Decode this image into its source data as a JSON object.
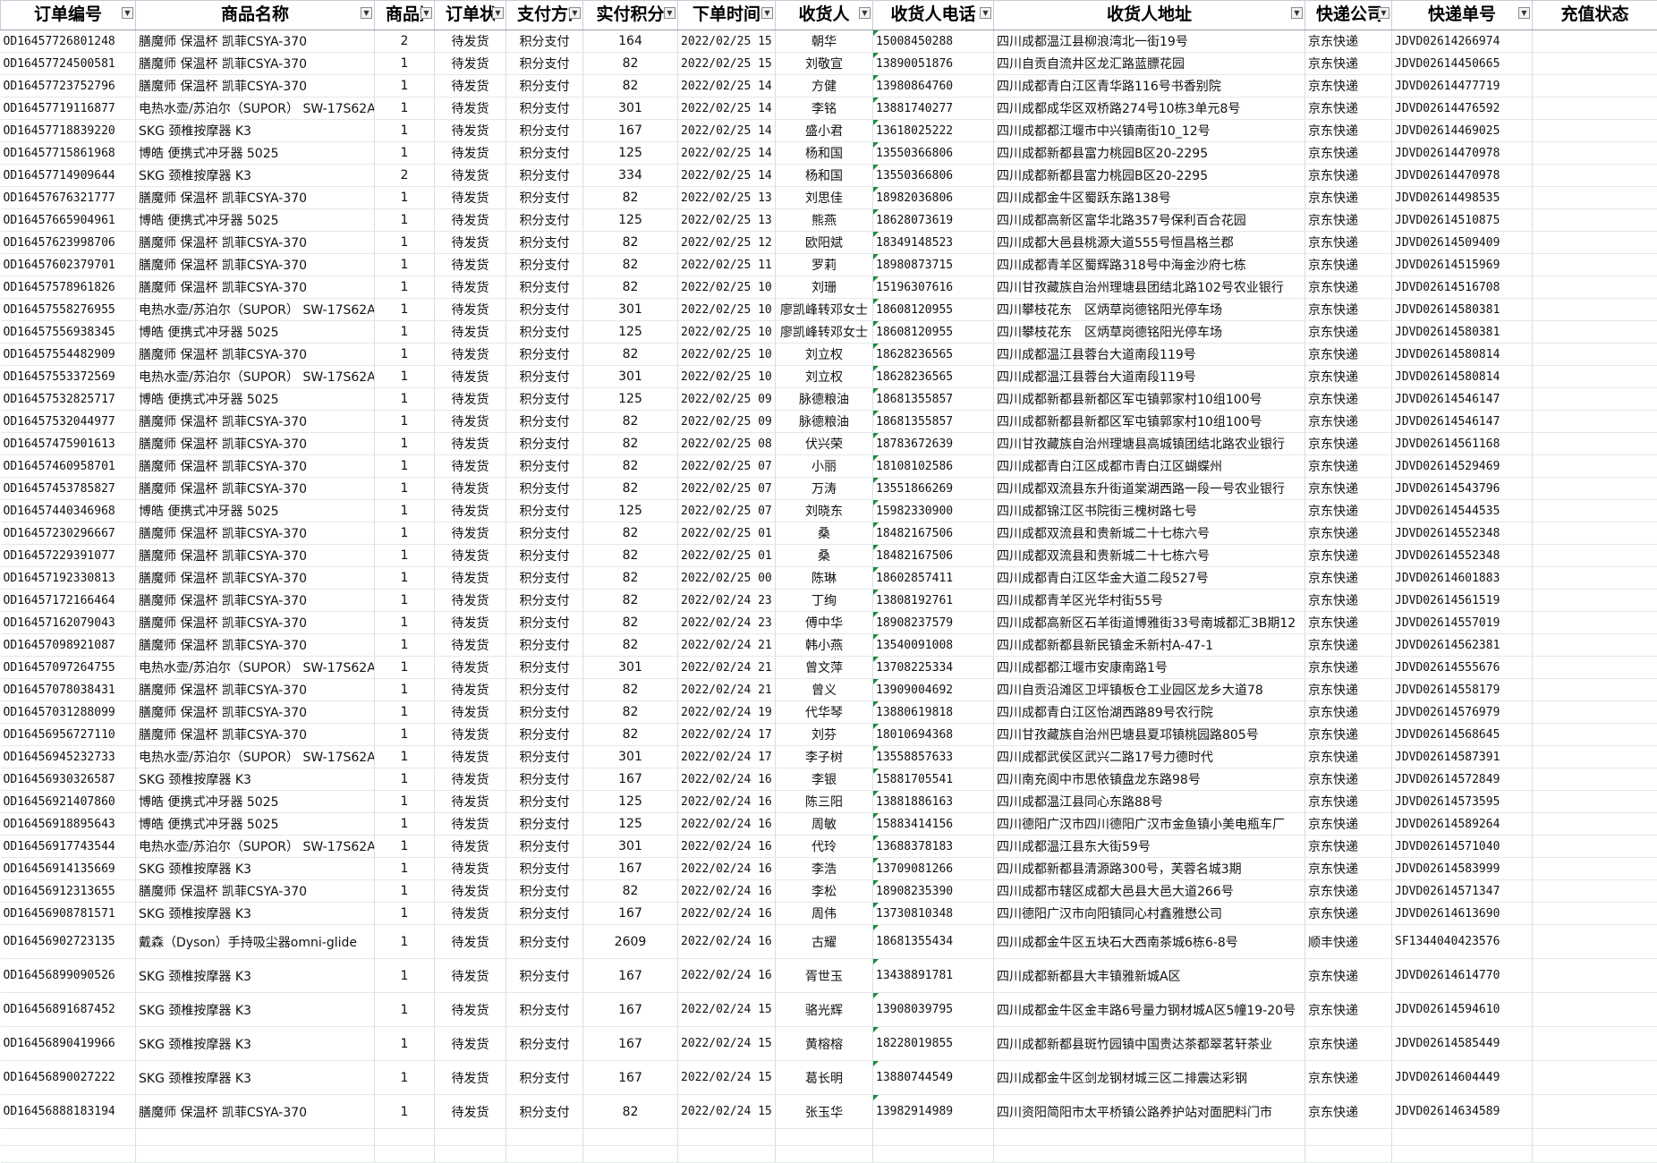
{
  "headers": [
    "订单编号",
    "商品名称",
    "商品数",
    "订单状",
    "支付方式",
    "实付积分",
    "下单时间",
    "收货人",
    "收货人电话",
    "收货人地址",
    "快递公司",
    "快递单号",
    "充值状态"
  ],
  "rows": [
    [
      "OD16457726801248",
      "膳魔师 保温杯 凯菲CSYA-370",
      "2",
      "待发货",
      "积分支付",
      "164",
      "2022/02/25 15",
      "朝华",
      "15008450288",
      "四川成都温江县柳浪湾北一街19号",
      "京东快递",
      "JDVD02614266974",
      ""
    ],
    [
      "OD16457724500581",
      "膳魔师 保温杯 凯菲CSYA-370",
      "1",
      "待发货",
      "积分支付",
      "82",
      "2022/02/25 15",
      "刘敬宣",
      "13890051876",
      "四川自贡自流井区龙汇路蓝膘花园",
      "京东快递",
      "JDVD02614450665",
      ""
    ],
    [
      "OD16457723752796",
      "膳魔师 保温杯 凯菲CSYA-370",
      "1",
      "待发货",
      "积分支付",
      "82",
      "2022/02/25 14",
      "方健",
      "13980864760",
      "四川成都青白江区青华路116号书香别院",
      "京东快递",
      "JDVD02614477719",
      ""
    ],
    [
      "OD16457719116877",
      "电热水壶/苏泊尔（SUPOR） SW-17S62A",
      "1",
      "待发货",
      "积分支付",
      "301",
      "2022/02/25 14",
      "李铭",
      "13881740277",
      "四川成都成华区双桥路274号10栋3单元8号",
      "京东快递",
      "JDVD02614476592",
      ""
    ],
    [
      "OD16457718839220",
      "SKG 颈椎按摩器 K3",
      "1",
      "待发货",
      "积分支付",
      "167",
      "2022/02/25 14",
      "盛小君",
      "13618025222",
      "四川成都都江堰市中兴镇南街10_12号",
      "京东快递",
      "JDVD02614469025",
      ""
    ],
    [
      "OD16457715861968",
      "博皓 便携式冲牙器 5025",
      "1",
      "待发货",
      "积分支付",
      "125",
      "2022/02/25 14",
      "杨和国",
      "13550366806",
      "四川成都新都县富力桃园B区20-2295",
      "京东快递",
      "JDVD02614470978",
      ""
    ],
    [
      "OD16457714909644",
      "SKG 颈椎按摩器 K3",
      "2",
      "待发货",
      "积分支付",
      "334",
      "2022/02/25 14",
      "杨和国",
      "13550366806",
      "四川成都新都县富力桃园B区20-2295",
      "京东快递",
      "JDVD02614470978",
      ""
    ],
    [
      "OD16457676321777",
      "膳魔师 保温杯 凯菲CSYA-370",
      "1",
      "待发货",
      "积分支付",
      "82",
      "2022/02/25 13",
      "刘思佳",
      "18982036806",
      "四川成都金牛区蜀跃东路138号",
      "京东快递",
      "JDVD02614498535",
      ""
    ],
    [
      "OD16457665904961",
      "博皓 便携式冲牙器 5025",
      "1",
      "待发货",
      "积分支付",
      "125",
      "2022/02/25 13",
      "熊燕",
      "18628073619",
      "四川成都高新区富华北路357号保利百合花园",
      "京东快递",
      "JDVD02614510875",
      ""
    ],
    [
      "OD16457623998706",
      "膳魔师 保温杯 凯菲CSYA-370",
      "1",
      "待发货",
      "积分支付",
      "82",
      "2022/02/25 12",
      "欧阳斌",
      "18349148523",
      "四川成都大邑县桃源大道555号恒昌格兰郡",
      "京东快递",
      "JDVD02614509409",
      ""
    ],
    [
      "OD16457602379701",
      "膳魔师 保温杯 凯菲CSYA-370",
      "1",
      "待发货",
      "积分支付",
      "82",
      "2022/02/25 11",
      "罗莉",
      "18980873715",
      "四川成都青羊区蜀辉路318号中海金沙府七栋",
      "京东快递",
      "JDVD02614515969",
      ""
    ],
    [
      "OD16457578961826",
      "膳魔师 保温杯 凯菲CSYA-370",
      "1",
      "待发货",
      "积分支付",
      "82",
      "2022/02/25 10",
      "刘珊",
      "15196307616",
      "四川甘孜藏族自治州理塘县团结北路102号农业银行",
      "京东快递",
      "JDVD02614516708",
      ""
    ],
    [
      "OD16457558276955",
      "电热水壶/苏泊尔（SUPOR） SW-17S62A",
      "1",
      "待发货",
      "积分支付",
      "301",
      "2022/02/25 10",
      "廖凯峰转邓女士",
      "18608120955",
      "四川攀枝花东　区炳草岗德铭阳光停车场",
      "京东快递",
      "JDVD02614580381",
      ""
    ],
    [
      "OD16457556938345",
      "博皓 便携式冲牙器 5025",
      "1",
      "待发货",
      "积分支付",
      "125",
      "2022/02/25 10",
      "廖凯峰转邓女士",
      "18608120955",
      "四川攀枝花东　区炳草岗德铭阳光停车场",
      "京东快递",
      "JDVD02614580381",
      ""
    ],
    [
      "OD16457554482909",
      "膳魔师 保温杯 凯菲CSYA-370",
      "1",
      "待发货",
      "积分支付",
      "82",
      "2022/02/25 10",
      "刘立权",
      "18628236565",
      "四川成都温江县蓉台大道南段119号",
      "京东快递",
      "JDVD02614580814",
      ""
    ],
    [
      "OD16457553372569",
      "电热水壶/苏泊尔（SUPOR） SW-17S62A",
      "1",
      "待发货",
      "积分支付",
      "301",
      "2022/02/25 10",
      "刘立权",
      "18628236565",
      "四川成都温江县蓉台大道南段119号",
      "京东快递",
      "JDVD02614580814",
      ""
    ],
    [
      "OD16457532825717",
      "博皓 便携式冲牙器 5025",
      "1",
      "待发货",
      "积分支付",
      "125",
      "2022/02/25 09",
      "脉德粮油",
      "18681355857",
      "四川成都新都县新都区军屯镇郭家村10组100号",
      "京东快递",
      "JDVD02614546147",
      ""
    ],
    [
      "OD16457532044977",
      "膳魔师 保温杯 凯菲CSYA-370",
      "1",
      "待发货",
      "积分支付",
      "82",
      "2022/02/25 09",
      "脉德粮油",
      "18681355857",
      "四川成都新都县新都区军屯镇郭家村10组100号",
      "京东快递",
      "JDVD02614546147",
      ""
    ],
    [
      "OD16457475901613",
      "膳魔师 保温杯 凯菲CSYA-370",
      "1",
      "待发货",
      "积分支付",
      "82",
      "2022/02/25 08",
      "伏兴荣",
      "18783672639",
      "四川甘孜藏族自治州理塘县高城镇团结北路农业银行",
      "京东快递",
      "JDVD02614561168",
      ""
    ],
    [
      "OD16457460958701",
      "膳魔师 保温杯 凯菲CSYA-370",
      "1",
      "待发货",
      "积分支付",
      "82",
      "2022/02/25 07",
      "小丽",
      "18108102586",
      "四川成都青白江区成都市青白江区蝴蝶州",
      "京东快递",
      "JDVD02614529469",
      ""
    ],
    [
      "OD16457453785827",
      "膳魔师 保温杯 凯菲CSYA-370",
      "1",
      "待发货",
      "积分支付",
      "82",
      "2022/02/25 07",
      "万涛",
      "13551866269",
      "四川成都双流县东升街道棠湖西路一段一号农业银行",
      "京东快递",
      "JDVD02614543796",
      ""
    ],
    [
      "OD16457440346968",
      "博皓 便携式冲牙器 5025",
      "1",
      "待发货",
      "积分支付",
      "125",
      "2022/02/25 07",
      "刘晓东",
      "15982330900",
      "四川成都锦江区书院街三槐树路七号",
      "京东快递",
      "JDVD02614544535",
      ""
    ],
    [
      "OD16457230296667",
      "膳魔师 保温杯 凯菲CSYA-370",
      "1",
      "待发货",
      "积分支付",
      "82",
      "2022/02/25 01",
      "桑",
      "18482167506",
      "四川成都双流县和贵新城二十七栋六号",
      "京东快递",
      "JDVD02614552348",
      ""
    ],
    [
      "OD16457229391077",
      "膳魔师 保温杯 凯菲CSYA-370",
      "1",
      "待发货",
      "积分支付",
      "82",
      "2022/02/25 01",
      "桑",
      "18482167506",
      "四川成都双流县和贵新城二十七栋六号",
      "京东快递",
      "JDVD02614552348",
      ""
    ],
    [
      "OD16457192330813",
      "膳魔师 保温杯 凯菲CSYA-370",
      "1",
      "待发货",
      "积分支付",
      "82",
      "2022/02/25 00",
      "陈琳",
      "18602857411",
      "四川成都青白江区华金大道二段527号",
      "京东快递",
      "JDVD02614601883",
      ""
    ],
    [
      "OD16457172166464",
      "膳魔师 保温杯 凯菲CSYA-370",
      "1",
      "待发货",
      "积分支付",
      "82",
      "2022/02/24 23",
      "丁绚",
      "13808192761",
      "四川成都青羊区光华村街55号",
      "京东快递",
      "JDVD02614561519",
      ""
    ],
    [
      "OD16457162079043",
      "膳魔师 保温杯 凯菲CSYA-370",
      "1",
      "待发货",
      "积分支付",
      "82",
      "2022/02/24 23",
      "傅中华",
      "18908237579",
      "四川成都高新区石羊街道博雅街33号南城都汇3B期12",
      "京东快递",
      "JDVD02614557019",
      ""
    ],
    [
      "OD16457098921087",
      "膳魔师 保温杯 凯菲CSYA-370",
      "1",
      "待发货",
      "积分支付",
      "82",
      "2022/02/24 21",
      "韩小燕",
      "13540091008",
      "四川成都新都县新民镇金禾新村A-47-1",
      "京东快递",
      "JDVD02614562381",
      ""
    ],
    [
      "OD16457097264755",
      "电热水壶/苏泊尔（SUPOR） SW-17S62A",
      "1",
      "待发货",
      "积分支付",
      "301",
      "2022/02/24 21",
      "曾文萍",
      "13708225334",
      "四川成都都江堰市安康南路1号",
      "京东快递",
      "JDVD02614555676",
      ""
    ],
    [
      "OD16457078038431",
      "膳魔师 保温杯 凯菲CSYA-370",
      "1",
      "待发货",
      "积分支付",
      "82",
      "2022/02/24 21",
      "曾义",
      "13909004692",
      "四川自贡沿滩区卫坪镇板仓工业园区龙乡大道78",
      "京东快递",
      "JDVD02614558179",
      ""
    ],
    [
      "OD16457031288099",
      "膳魔师 保温杯 凯菲CSYA-370",
      "1",
      "待发货",
      "积分支付",
      "82",
      "2022/02/24 19",
      "代华琴",
      "13880619818",
      "四川成都青白江区怡湖西路89号农行院",
      "京东快递",
      "JDVD02614576979",
      ""
    ],
    [
      "OD16456956727110",
      "膳魔师 保温杯 凯菲CSYA-370",
      "1",
      "待发货",
      "积分支付",
      "82",
      "2022/02/24 17",
      "刘芬",
      "18010694368",
      "四川甘孜藏族自治州巴塘县夏邛镇桃园路805号",
      "京东快递",
      "JDVD02614568645",
      ""
    ],
    [
      "OD16456945232733",
      "电热水壶/苏泊尔（SUPOR） SW-17S62A",
      "1",
      "待发货",
      "积分支付",
      "301",
      "2022/02/24 17",
      "李子树",
      "13558857633",
      "四川成都武侯区武兴二路17号力德时代",
      "京东快递",
      "JDVD02614587391",
      ""
    ],
    [
      "OD16456930326587",
      "SKG 颈椎按摩器 K3",
      "1",
      "待发货",
      "积分支付",
      "167",
      "2022/02/24 16",
      "李银",
      "15881705541",
      "四川南充阆中市思依镇盘龙东路98号",
      "京东快递",
      "JDVD02614572849",
      ""
    ],
    [
      "OD16456921407860",
      "博皓 便携式冲牙器 5025",
      "1",
      "待发货",
      "积分支付",
      "125",
      "2022/02/24 16",
      "陈三阳",
      "13881886163",
      "四川成都温江县同心东路88号",
      "京东快递",
      "JDVD02614573595",
      ""
    ],
    [
      "OD16456918895643",
      "博皓 便携式冲牙器 5025",
      "1",
      "待发货",
      "积分支付",
      "125",
      "2022/02/24 16",
      "周敏",
      "15883414156",
      "四川德阳广汉市四川德阳广汉市金鱼镇小美电瓶车厂",
      "京东快递",
      "JDVD02614589264",
      ""
    ],
    [
      "OD16456917743544",
      "电热水壶/苏泊尔（SUPOR） SW-17S62A",
      "1",
      "待发货",
      "积分支付",
      "301",
      "2022/02/24 16",
      "代玲",
      "13688378183",
      "四川成都温江县东大街59号",
      "京东快递",
      "JDVD02614571040",
      ""
    ],
    [
      "OD16456914135669",
      "SKG 颈椎按摩器 K3",
      "1",
      "待发货",
      "积分支付",
      "167",
      "2022/02/24 16",
      "李浩",
      "13709081266",
      "四川成都新都县清源路300号，芙蓉名城3期",
      "京东快递",
      "JDVD02614583999",
      ""
    ],
    [
      "OD16456912313655",
      "膳魔师 保温杯 凯菲CSYA-370",
      "1",
      "待发货",
      "积分支付",
      "82",
      "2022/02/24 16",
      "李松",
      "18908235390",
      "四川成都市辖区成都大邑县大邑大道266号",
      "京东快递",
      "JDVD02614571347",
      ""
    ],
    [
      "OD16456908781571",
      "SKG 颈椎按摩器 K3",
      "1",
      "待发货",
      "积分支付",
      "167",
      "2022/02/24 16",
      "周伟",
      "13730810348",
      "四川德阳广汉市向阳镇同心村鑫雅懋公司",
      "京东快递",
      "JDVD02614613690",
      ""
    ],
    [
      "OD16456902723135",
      "戴森（Dyson）手持吸尘器omni-glide",
      "1",
      "待发货",
      "积分支付",
      "2609",
      "2022/02/24 16",
      "古耀",
      "18681355434",
      "四川成都金牛区五块石大西南茶城6栋6-8号",
      "顺丰快递",
      "SF1344040423576",
      ""
    ],
    [
      "OD16456899090526",
      "SKG 颈椎按摩器 K3",
      "1",
      "待发货",
      "积分支付",
      "167",
      "2022/02/24 16",
      "胥世玉",
      "13438891781",
      "四川成都新都县大丰镇雅新城A区",
      "京东快递",
      "JDVD02614614770",
      ""
    ],
    [
      "OD16456891687452",
      "SKG 颈椎按摩器 K3",
      "1",
      "待发货",
      "积分支付",
      "167",
      "2022/02/24 15",
      "骆光辉",
      "13908039795",
      "四川成都金牛区金丰路6号量力钢材城A区5幢19-20号",
      "京东快递",
      "JDVD02614594610",
      ""
    ],
    [
      "OD16456890419966",
      "SKG 颈椎按摩器 K3",
      "1",
      "待发货",
      "积分支付",
      "167",
      "2022/02/24 15",
      "黄榕榕",
      "18228019855",
      "四川成都新都县斑竹园镇中国贵达茶都翠茗轩茶业",
      "京东快递",
      "JDVD02614585449",
      ""
    ],
    [
      "OD16456890027222",
      "SKG 颈椎按摩器 K3",
      "1",
      "待发货",
      "积分支付",
      "167",
      "2022/02/24 15",
      "葛长明",
      "13880744549",
      "四川成都金牛区剑龙钢材城三区二排震达彩钢",
      "京东快递",
      "JDVD02614604449",
      ""
    ],
    [
      "OD16456888183194",
      "膳魔师 保温杯 凯菲CSYA-370",
      "1",
      "待发货",
      "积分支付",
      "82",
      "2022/02/24 15",
      "张玉华",
      "13982914989",
      "四川资阳简阳市太平桥镇公路养护站对面肥料门市",
      "京东快递",
      "JDVD02614634589",
      ""
    ],
    [
      "",
      "",
      "",
      "",
      "",
      "",
      "",
      "",
      "",
      "",
      "",
      "",
      ""
    ],
    [
      "",
      "",
      "",
      "",
      "",
      "",
      "",
      "",
      "",
      "",
      "",
      "",
      ""
    ]
  ]
}
